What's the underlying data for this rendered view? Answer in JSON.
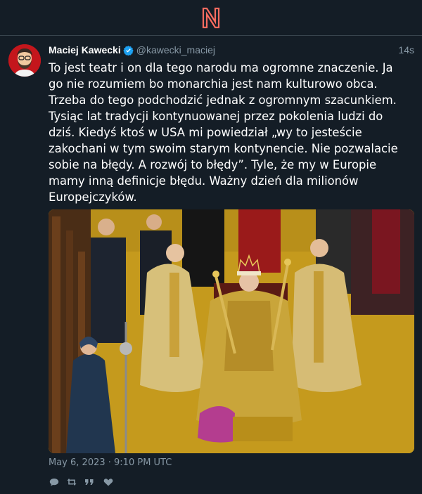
{
  "header": {
    "logo_icon": "nitter-n-logo",
    "accent": "#ff6c60"
  },
  "tweet": {
    "author_name": "Maciej Kawecki",
    "verified": true,
    "handle": "@kawecki_maciej",
    "relative_time": "14s",
    "text": "To jest teatr i on dla tego narodu ma ogromne znaczenie. Ja go nie rozumiem bo monarchia jest nam kulturowo obca. Trzeba do tego podchodzić jednak z ogromnym szacunkiem. Tysiąc lat tradycji kontynuowanej przez pokolenia ludzi do dziś. Kiedyś ktoś w USA mi powiedział „wy to jesteście zakochani w tym swoim starym kontynencie. Nie pozwalacie sobie na błędy. A rozwój to błędy”. Tyle, że my w Europie mamy inną definicje błędu. Ważny dzień dla milionów Europejczyków.",
    "date": "May 6, 2023 · 9:10 PM UTC",
    "actions": [
      "reply-icon",
      "retweet-icon",
      "quote-icon",
      "like-icon"
    ],
    "colors": {
      "background": "#141d26",
      "muted": "#8899a6",
      "verified": "#1da1f2"
    }
  }
}
